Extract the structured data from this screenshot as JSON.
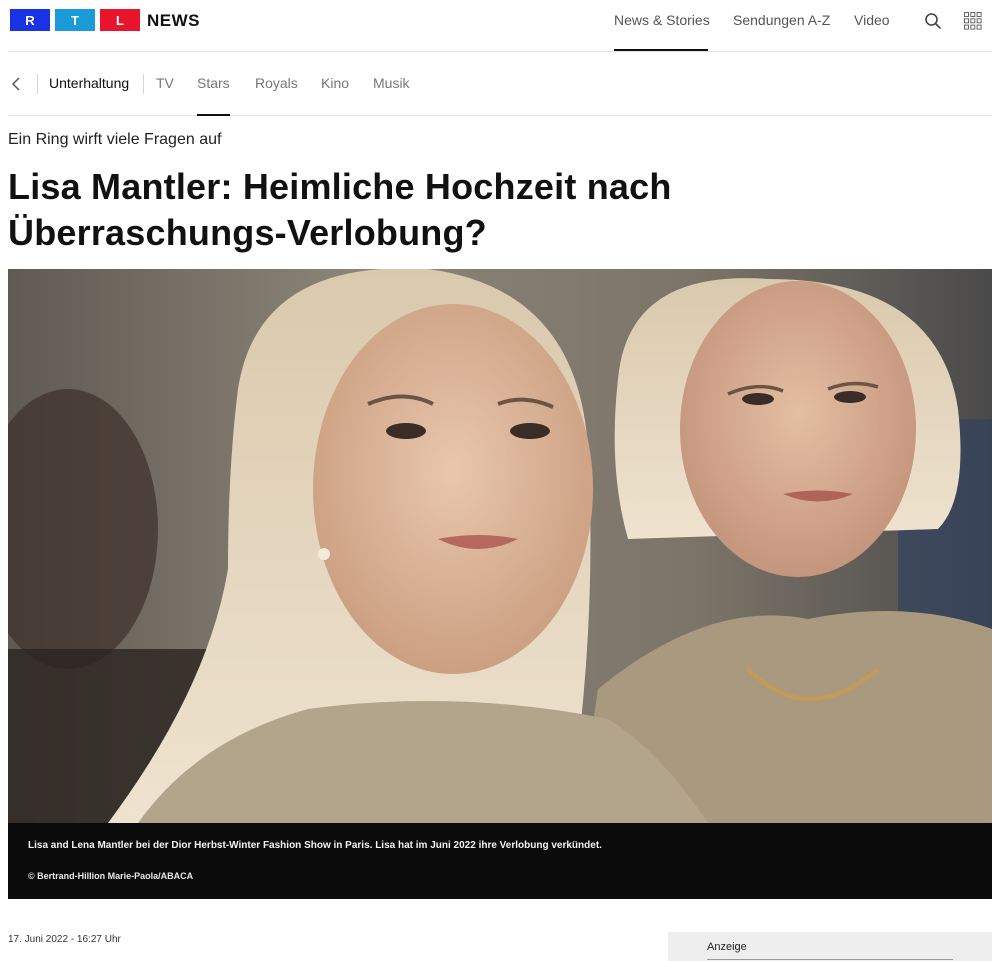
{
  "header": {
    "logo_letters": [
      "R",
      "T",
      "L"
    ],
    "logo_colors": [
      "#1a32e6",
      "#1a9ad8",
      "#e8142c"
    ],
    "brand": "NEWS",
    "nav": [
      "News & Stories",
      "Sendungen A-Z",
      "Video"
    ],
    "active_nav": "News & Stories",
    "icons": [
      "search-icon",
      "grid-menu-icon"
    ]
  },
  "subnav": {
    "back_icon": "chevron-left-icon",
    "items": [
      "Unterhaltung",
      "TV",
      "Stars",
      "Royals",
      "Kino",
      "Musik"
    ],
    "active": "Stars"
  },
  "article": {
    "kicker": "Ein Ring wirft viele Fragen auf",
    "headline": "Lisa Mantler: Heimliche Hochzeit nach Überraschungs-Verlobung?",
    "headline_line1": "Lisa Mantler: Heimliche Hochzeit nach",
    "headline_line2": "Überraschungs-Verlobung?",
    "image_caption": "Lisa and Lena Mantler bei der Dior Herbst-Winter Fashion Show in Paris. Lisa hat im Juni 2022 ihre Verlobung verkündet.",
    "image_credit": "© Bertrand-Hillion Marie-Paola/ABACA",
    "date": "17. Juni 2022 - 16:27 Uhr"
  },
  "ad": {
    "label": "Anzeige"
  }
}
